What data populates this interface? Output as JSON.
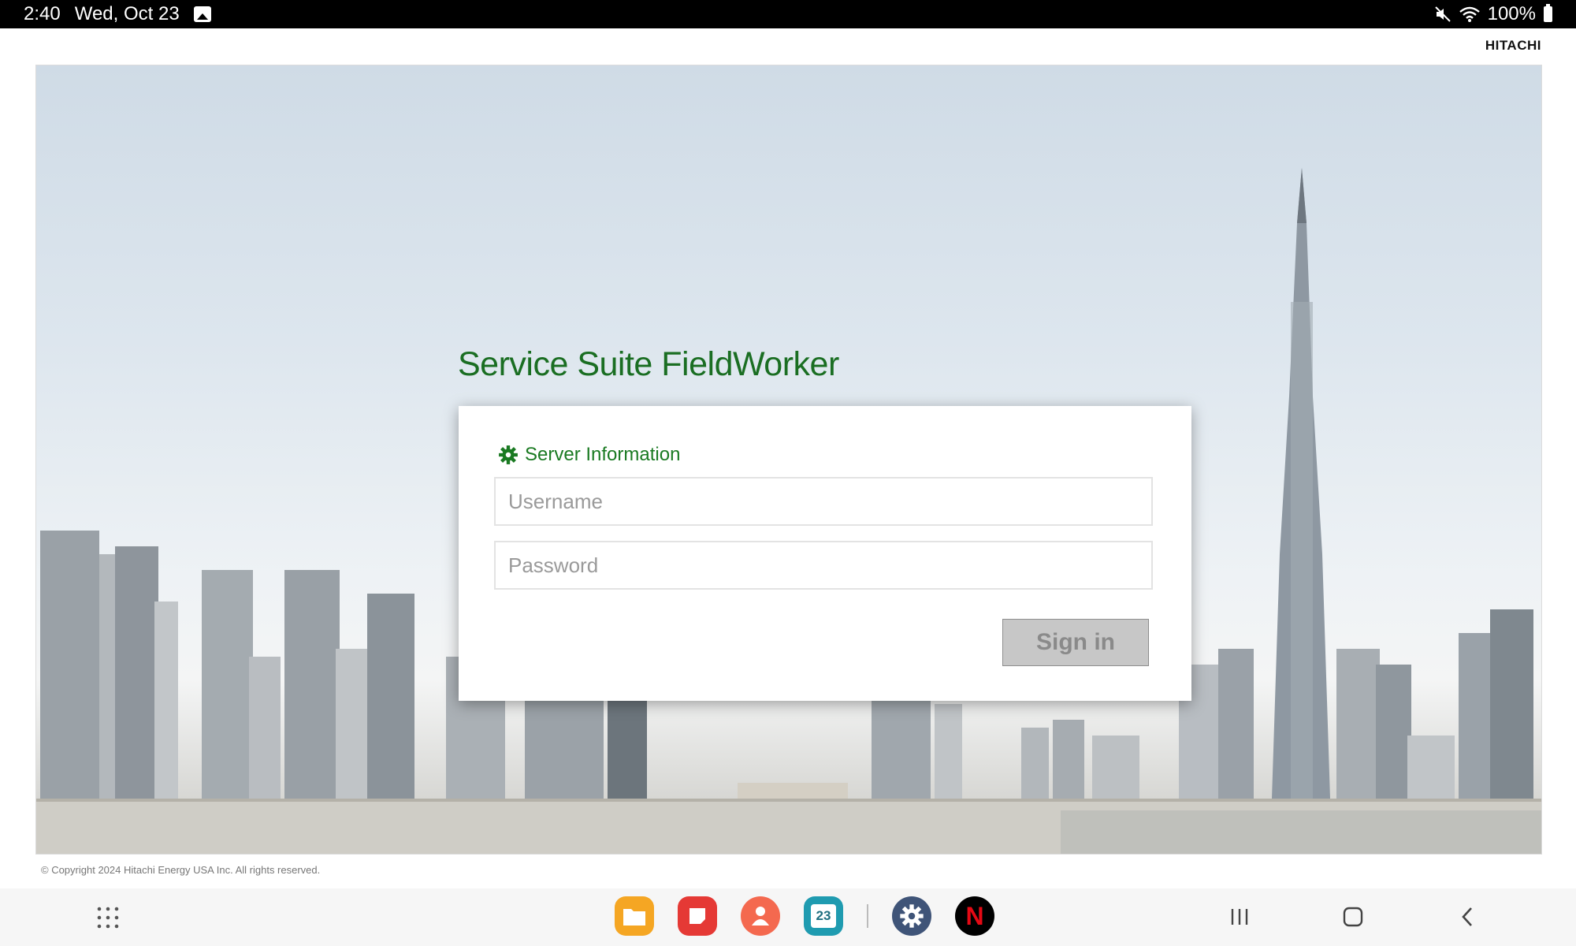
{
  "status_bar": {
    "time": "2:40",
    "date": "Wed, Oct 23",
    "battery": "100%",
    "icons": [
      "image-notification-icon",
      "mute-icon",
      "wifi-icon",
      "battery-icon"
    ]
  },
  "brand": "HITACHI",
  "login": {
    "title": "Service Suite FieldWorker",
    "server_info_label": "Server Information",
    "username_placeholder": "Username",
    "username_value": "",
    "password_placeholder": "Password",
    "password_value": "",
    "signin_label": "Sign in"
  },
  "footer": {
    "copyright": "© Copyright 2024 Hitachi Energy USA Inc. All rights reserved."
  },
  "nav_bar": {
    "dock_apps": [
      {
        "name": "files-app-icon",
        "color": "#f5a623"
      },
      {
        "name": "notes-app-icon",
        "color": "#e53935"
      },
      {
        "name": "contacts-app-icon",
        "color": "#f4694f"
      },
      {
        "name": "calendar-app-icon",
        "color": "#1f9bb0",
        "text": "23"
      },
      {
        "name": "settings-app-icon",
        "color": "#3f5478"
      },
      {
        "name": "netflix-app-icon",
        "color": "#000000",
        "text": "N"
      }
    ],
    "buttons": [
      "recents-icon",
      "home-icon",
      "back-icon"
    ]
  },
  "colors": {
    "title_green": "#1a6e22",
    "link_green": "#1a7a22",
    "button_disabled": "#c7c7c7"
  }
}
